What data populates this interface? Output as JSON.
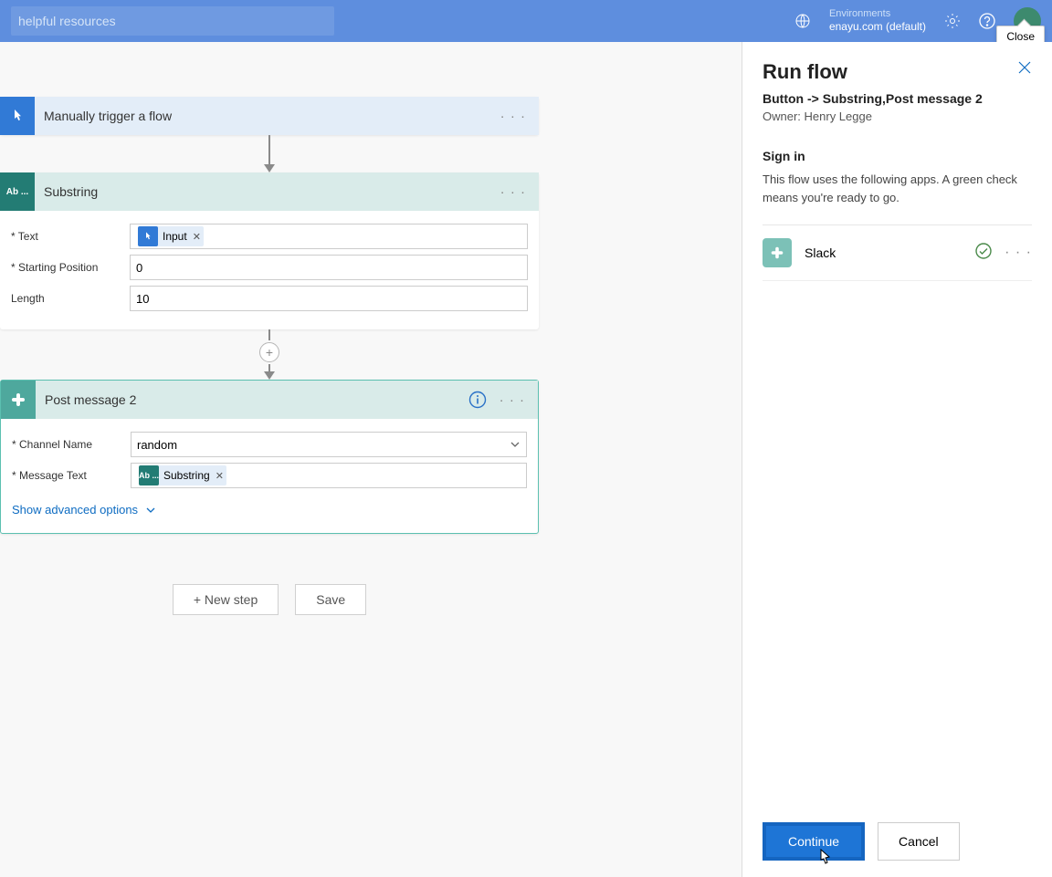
{
  "topbar": {
    "search_placeholder": "helpful resources",
    "env_label": "Environments",
    "env_value": "enayu.com (default)"
  },
  "tooltip": {
    "close": "Close"
  },
  "cards": {
    "trigger": {
      "title": "Manually trigger a flow"
    },
    "substring": {
      "title": "Substring",
      "icon_text": "Ab ...",
      "fields": {
        "text_label": "Text",
        "text_token": "Input",
        "start_label": "Starting Position",
        "start_value": "0",
        "length_label": "Length",
        "length_value": "10"
      }
    },
    "post": {
      "title": "Post message 2",
      "fields": {
        "channel_label": "Channel Name",
        "channel_value": "random",
        "message_label": "Message Text",
        "message_token": "Substring",
        "message_token_icon": "Ab ..."
      },
      "adv": "Show advanced options"
    }
  },
  "bottom": {
    "new_step": "+ New step",
    "save": "Save"
  },
  "panel": {
    "title": "Run flow",
    "subtitle": "Button -> Substring,Post message 2",
    "owner": "Owner: Henry Legge",
    "signin": "Sign in",
    "desc": "This flow uses the following apps. A green check means you're ready to go.",
    "conn_name": "Slack",
    "continue": "Continue",
    "cancel": "Cancel"
  }
}
